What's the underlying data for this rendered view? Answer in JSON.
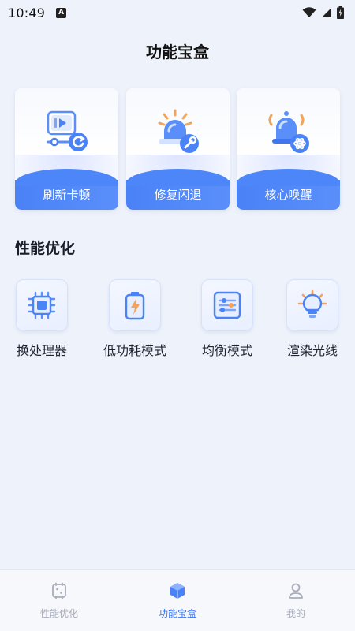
{
  "status_bar": {
    "time": "10:49",
    "notification_icon": "a-badge-icon",
    "icons": [
      "wifi-icon",
      "signal-icon",
      "battery-charging-icon"
    ]
  },
  "header": {
    "title": "功能宝盒"
  },
  "feature_cards": [
    {
      "label": "刷新卡顿",
      "icon": "refresh-lag-icon"
    },
    {
      "label": "修复闪退",
      "icon": "repair-crash-icon"
    },
    {
      "label": "核心唤醒",
      "icon": "core-wake-icon"
    }
  ],
  "performance": {
    "title": "性能优化",
    "tools": [
      {
        "label": "换处理器",
        "icon": "processor-chip-icon"
      },
      {
        "label": "低功耗模式",
        "icon": "battery-saver-icon"
      },
      {
        "label": "均衡模式",
        "icon": "balance-slider-icon"
      },
      {
        "label": "渲染光线",
        "icon": "light-bulb-icon"
      }
    ]
  },
  "bottom_nav": {
    "items": [
      {
        "label": "性能优化",
        "icon": "dice-box-icon",
        "active": false
      },
      {
        "label": "功能宝盒",
        "icon": "cube-box-icon",
        "active": true
      },
      {
        "label": "我的",
        "icon": "user-profile-icon",
        "active": false
      }
    ]
  },
  "colors": {
    "accent": "#4a82f7",
    "background": "#eef2fa",
    "nav_inactive": "#a8adba"
  }
}
